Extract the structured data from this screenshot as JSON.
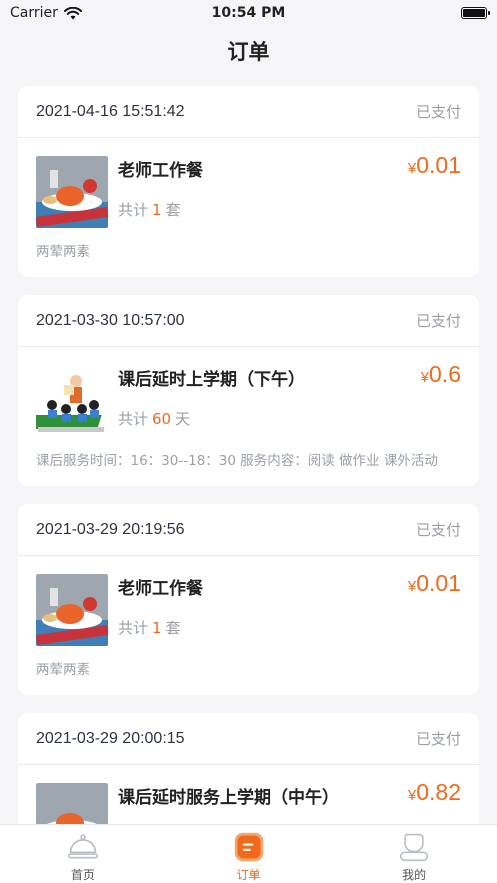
{
  "status_bar": {
    "carrier": "Carrier",
    "time": "10:54 PM"
  },
  "nav": {
    "title": "订单"
  },
  "orders": [
    {
      "datetime": "2021-04-16 15:51:42",
      "status": "已支付",
      "title": "老师工作餐",
      "count_prefix": "共计",
      "count": "1",
      "count_unit": "套",
      "currency": "¥",
      "price": "0.01",
      "note": "两荤两素",
      "thumb": "meal"
    },
    {
      "datetime": "2021-03-30 10:57:00",
      "status": "已支付",
      "title": "课后延时上学期（下午）",
      "count_prefix": "共计",
      "count": "60",
      "count_unit": "天",
      "currency": "¥",
      "price": "0.6",
      "note": "课后服务时间：16：30--18：30  服务内容：阅读  做作业  课外活动",
      "thumb": "class"
    },
    {
      "datetime": "2021-03-29 20:19:56",
      "status": "已支付",
      "title": "老师工作餐",
      "count_prefix": "共计",
      "count": "1",
      "count_unit": "套",
      "currency": "¥",
      "price": "0.01",
      "note": "两荤两素",
      "thumb": "meal"
    },
    {
      "datetime": "2021-03-29 20:00:15",
      "status": "已支付",
      "title": "课后延时服务上学期（中午）",
      "count_prefix": "共计",
      "count": "",
      "count_unit": "",
      "currency": "¥",
      "price": "0.82",
      "note": "",
      "thumb": "meal"
    }
  ],
  "tabs": [
    {
      "label": "首页",
      "icon": "cloche-icon",
      "active": false
    },
    {
      "label": "订单",
      "icon": "order-list-icon",
      "active": true
    },
    {
      "label": "我的",
      "icon": "profile-icon",
      "active": false
    }
  ],
  "colors": {
    "accent": "#f06a1d",
    "muted": "#9aa0a6",
    "background": "#f5f5f7"
  }
}
